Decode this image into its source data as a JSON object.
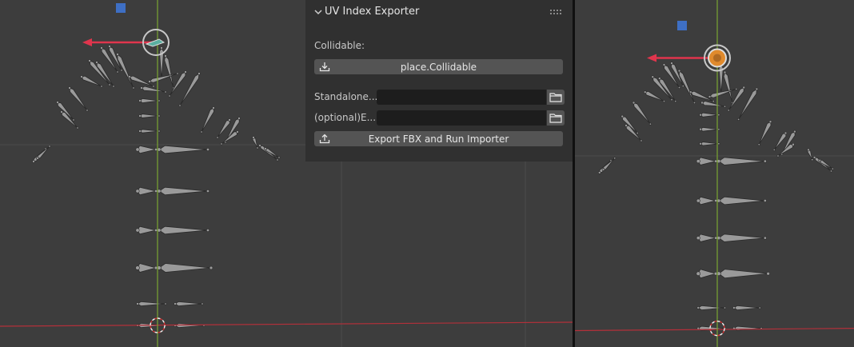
{
  "panel": {
    "title": "UV Index Exporter",
    "collidable_label": "Collidable:",
    "collidable_button": "place.Collidable",
    "standalone_label": "Standalone...",
    "standalone_value": "",
    "optional_label": "(optional)E...",
    "optional_value": "",
    "export_button": "Export FBX and Run Importer"
  },
  "icons": {
    "collapse": "chevron-down-icon",
    "drag": "grip-icon",
    "import": "download-icon",
    "export": "upload-icon",
    "browse": "folder-icon"
  },
  "colors": {
    "viewport_bg": "#3d3d3d",
    "panel_bg": "#303030",
    "button_bg": "#545454",
    "field_bg": "#1d1d1d",
    "x_axis": "#b3303a",
    "y_axis": "#7aa532",
    "gizmo_arrow": "#e0354d",
    "bone": "#9a9a9a",
    "selection_orange": "#e08a2c",
    "empty_blue": "#3e6fc4"
  }
}
